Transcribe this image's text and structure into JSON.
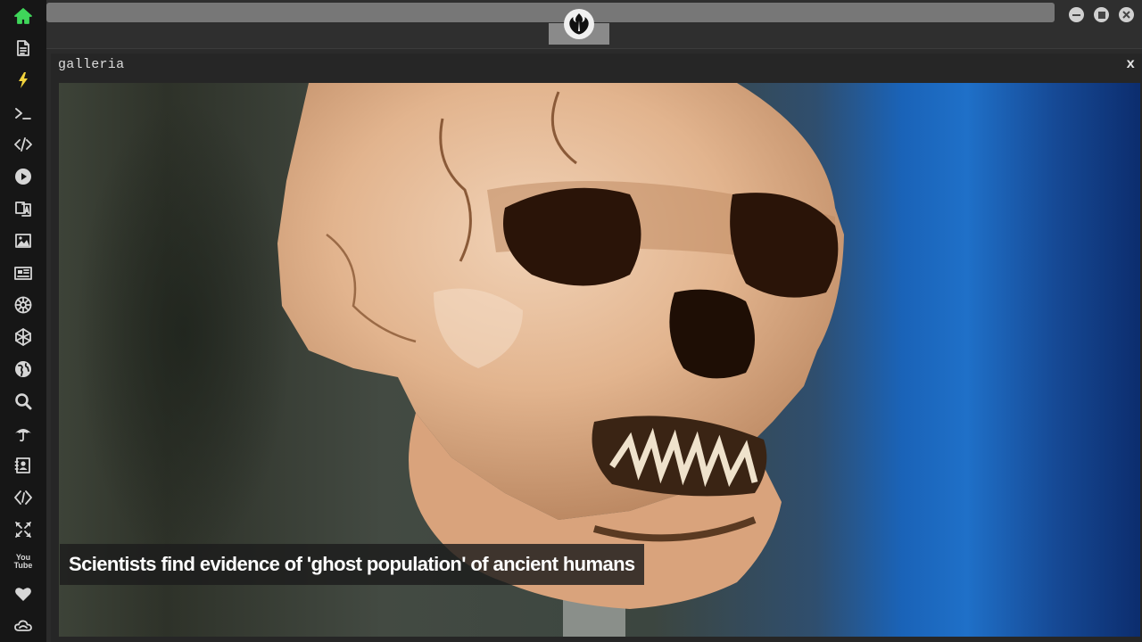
{
  "window": {
    "url_value": "",
    "logo_icon": "rebel-alliance-icon",
    "controls": [
      "minimize-icon",
      "maximize-icon",
      "close-icon"
    ]
  },
  "sidebar": {
    "icons": [
      "home-icon",
      "document-icon",
      "bolt-icon",
      "terminal-icon",
      "code-icon",
      "play-icon",
      "translate-icon",
      "image-icon",
      "news-icon",
      "empire-icon",
      "polygon-icon",
      "globe-icon",
      "search-icon",
      "umbrella-icon",
      "contacts-icon",
      "diamond-code-icon",
      "expand-icon",
      "youtube-icon",
      "heart-icon",
      "cloud-icon"
    ],
    "youtube_label_top": "You",
    "youtube_label_bottom": "Tube",
    "active_color": "#3fd65a"
  },
  "panel": {
    "title": "galleria",
    "close_label": "x",
    "image_subject": "skull photo",
    "caption": "Scientists find evidence of 'ghost population' of ancient humans"
  }
}
